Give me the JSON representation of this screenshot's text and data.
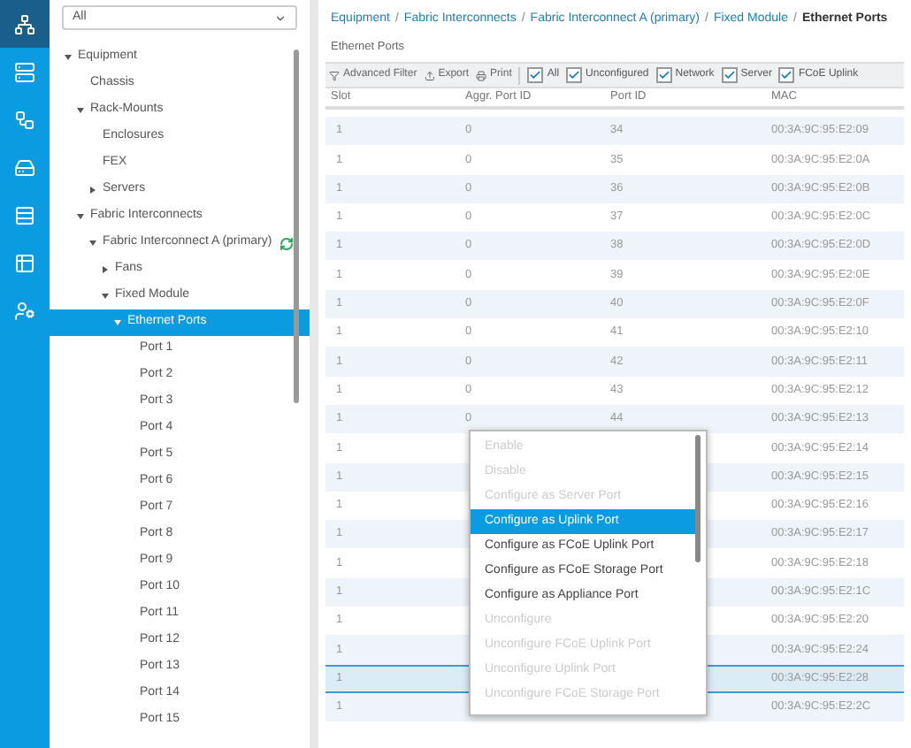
{
  "nav_rail": [
    {
      "selected": true
    },
    {
      "selected": false
    },
    {
      "selected": false
    },
    {
      "selected": false
    },
    {
      "selected": false
    },
    {
      "selected": false
    },
    {
      "selected": false
    }
  ],
  "filter_dropdown": {
    "value": "All"
  },
  "tree": [
    {
      "label": "Equipment",
      "expanded": true,
      "selected": false,
      "children": [
        {
          "label": "Chassis",
          "selected": false
        },
        {
          "label": "Rack-Mounts",
          "expanded": true,
          "selected": false,
          "children": [
            {
              "label": "Enclosures",
              "selected": false
            },
            {
              "label": "FEX",
              "selected": false
            },
            {
              "label": "Servers",
              "expanded": false,
              "selected": false
            }
          ]
        },
        {
          "label": "Fabric Interconnects",
          "expanded": true,
          "selected": false,
          "children": [
            {
              "label": "Fabric Interconnect A (primary)",
              "expanded": true,
              "selected": false,
              "status": true,
              "children": [
                {
                  "label": "Fans",
                  "expanded": false,
                  "selected": false
                },
                {
                  "label": "Fixed Module",
                  "expanded": true,
                  "selected": false,
                  "children": [
                    {
                      "label": "Ethernet Ports",
                      "expanded": true,
                      "selected": true,
                      "children": [
                        {
                          "label": "Port 1",
                          "selected": false
                        },
                        {
                          "label": "Port 2",
                          "selected": false
                        },
                        {
                          "label": "Port 3",
                          "selected": false
                        },
                        {
                          "label": "Port 4",
                          "selected": false
                        },
                        {
                          "label": "Port 5",
                          "selected": false
                        },
                        {
                          "label": "Port 6",
                          "selected": false
                        },
                        {
                          "label": "Port 7",
                          "selected": false
                        },
                        {
                          "label": "Port 8",
                          "selected": false
                        },
                        {
                          "label": "Port 9",
                          "selected": false
                        },
                        {
                          "label": "Port 10",
                          "selected": false
                        },
                        {
                          "label": "Port 11",
                          "selected": false
                        },
                        {
                          "label": "Port 12",
                          "selected": false
                        },
                        {
                          "label": "Port 13",
                          "selected": false
                        },
                        {
                          "label": "Port 14",
                          "selected": false
                        },
                        {
                          "label": "Port 15",
                          "selected": false
                        }
                      ]
                    }
                  ]
                }
              ]
            }
          ]
        }
      ]
    }
  ],
  "breadcrumb": [
    "Equipment",
    "Fabric Interconnects",
    "Fabric Interconnect A (primary)",
    "Fixed Module",
    "Ethernet Ports"
  ],
  "breadcrumb_separator": "/",
  "section_title": "Ethernet Ports",
  "toolbar": {
    "actions": [
      "Advanced Filter",
      "Export",
      "Print"
    ],
    "filters": [
      {
        "label": "All",
        "checked": true
      },
      {
        "label": "Unconfigured",
        "checked": true
      },
      {
        "label": "Network",
        "checked": true
      },
      {
        "label": "Server",
        "checked": true
      },
      {
        "label": "FCoE Uplink",
        "checked": true
      }
    ]
  },
  "table": {
    "columns": [
      "Slot",
      "Aggr. Port ID",
      "Port ID",
      "MAC"
    ],
    "rows": [
      {
        "slot": "1",
        "aggr": "0",
        "port": "34",
        "mac": "00:3A:9C:95:E2:09",
        "selected": false
      },
      {
        "slot": "1",
        "aggr": "0",
        "port": "35",
        "mac": "00:3A:9C:95:E2:0A",
        "selected": false
      },
      {
        "slot": "1",
        "aggr": "0",
        "port": "36",
        "mac": "00:3A:9C:95:E2:0B",
        "selected": false
      },
      {
        "slot": "1",
        "aggr": "0",
        "port": "37",
        "mac": "00:3A:9C:95:E2:0C",
        "selected": false
      },
      {
        "slot": "1",
        "aggr": "0",
        "port": "38",
        "mac": "00:3A:9C:95:E2:0D",
        "selected": false
      },
      {
        "slot": "1",
        "aggr": "0",
        "port": "39",
        "mac": "00:3A:9C:95:E2:0E",
        "selected": false
      },
      {
        "slot": "1",
        "aggr": "0",
        "port": "40",
        "mac": "00:3A:9C:95:E2:0F",
        "selected": false
      },
      {
        "slot": "1",
        "aggr": "0",
        "port": "41",
        "mac": "00:3A:9C:95:E2:10",
        "selected": false
      },
      {
        "slot": "1",
        "aggr": "0",
        "port": "42",
        "mac": "00:3A:9C:95:E2:11",
        "selected": false
      },
      {
        "slot": "1",
        "aggr": "0",
        "port": "43",
        "mac": "00:3A:9C:95:E2:12",
        "selected": false
      },
      {
        "slot": "1",
        "aggr": "0",
        "port": "44",
        "mac": "00:3A:9C:95:E2:13",
        "selected": false
      },
      {
        "slot": "1",
        "mac": "00:3A:9C:95:E2:14",
        "selected": false
      },
      {
        "slot": "1",
        "mac": "00:3A:9C:95:E2:15",
        "selected": false
      },
      {
        "slot": "1",
        "mac": "00:3A:9C:95:E2:16",
        "selected": false
      },
      {
        "slot": "1",
        "mac": "00:3A:9C:95:E2:17",
        "selected": false
      },
      {
        "slot": "1",
        "mac": "00:3A:9C:95:E2:18",
        "selected": false
      },
      {
        "slot": "1",
        "mac": "00:3A:9C:95:E2:1C",
        "selected": false
      },
      {
        "slot": "1",
        "mac": "00:3A:9C:95:E2:20",
        "selected": false
      },
      {
        "slot": "1",
        "mac": "00:3A:9C:95:E2:24",
        "selected": false
      },
      {
        "slot": "1",
        "mac": "00:3A:9C:95:E2:28",
        "selected": true
      },
      {
        "slot": "1",
        "mac": "00:3A:9C:95:E2:2C",
        "selected": false
      }
    ]
  },
  "context_menu": [
    {
      "label": "Enable",
      "disabled": true,
      "selected": false
    },
    {
      "label": "Disable",
      "disabled": true,
      "selected": false
    },
    {
      "label": "Configure as Server Port",
      "disabled": true,
      "selected": false
    },
    {
      "label": "Configure as Uplink Port",
      "disabled": false,
      "selected": true
    },
    {
      "label": "Configure as FCoE Uplink Port",
      "disabled": false,
      "selected": false
    },
    {
      "label": "Configure as FCoE Storage Port",
      "disabled": false,
      "selected": false
    },
    {
      "label": "Configure as Appliance Port",
      "disabled": false,
      "selected": false
    },
    {
      "label": "Unconfigure",
      "disabled": true,
      "selected": false
    },
    {
      "label": "Unconfigure FCoE Uplink Port",
      "disabled": true,
      "selected": false
    },
    {
      "label": "Unconfigure Uplink Port",
      "disabled": true,
      "selected": false
    },
    {
      "label": "Unconfigure FCoE Storage Port",
      "disabled": true,
      "selected": false
    }
  ]
}
